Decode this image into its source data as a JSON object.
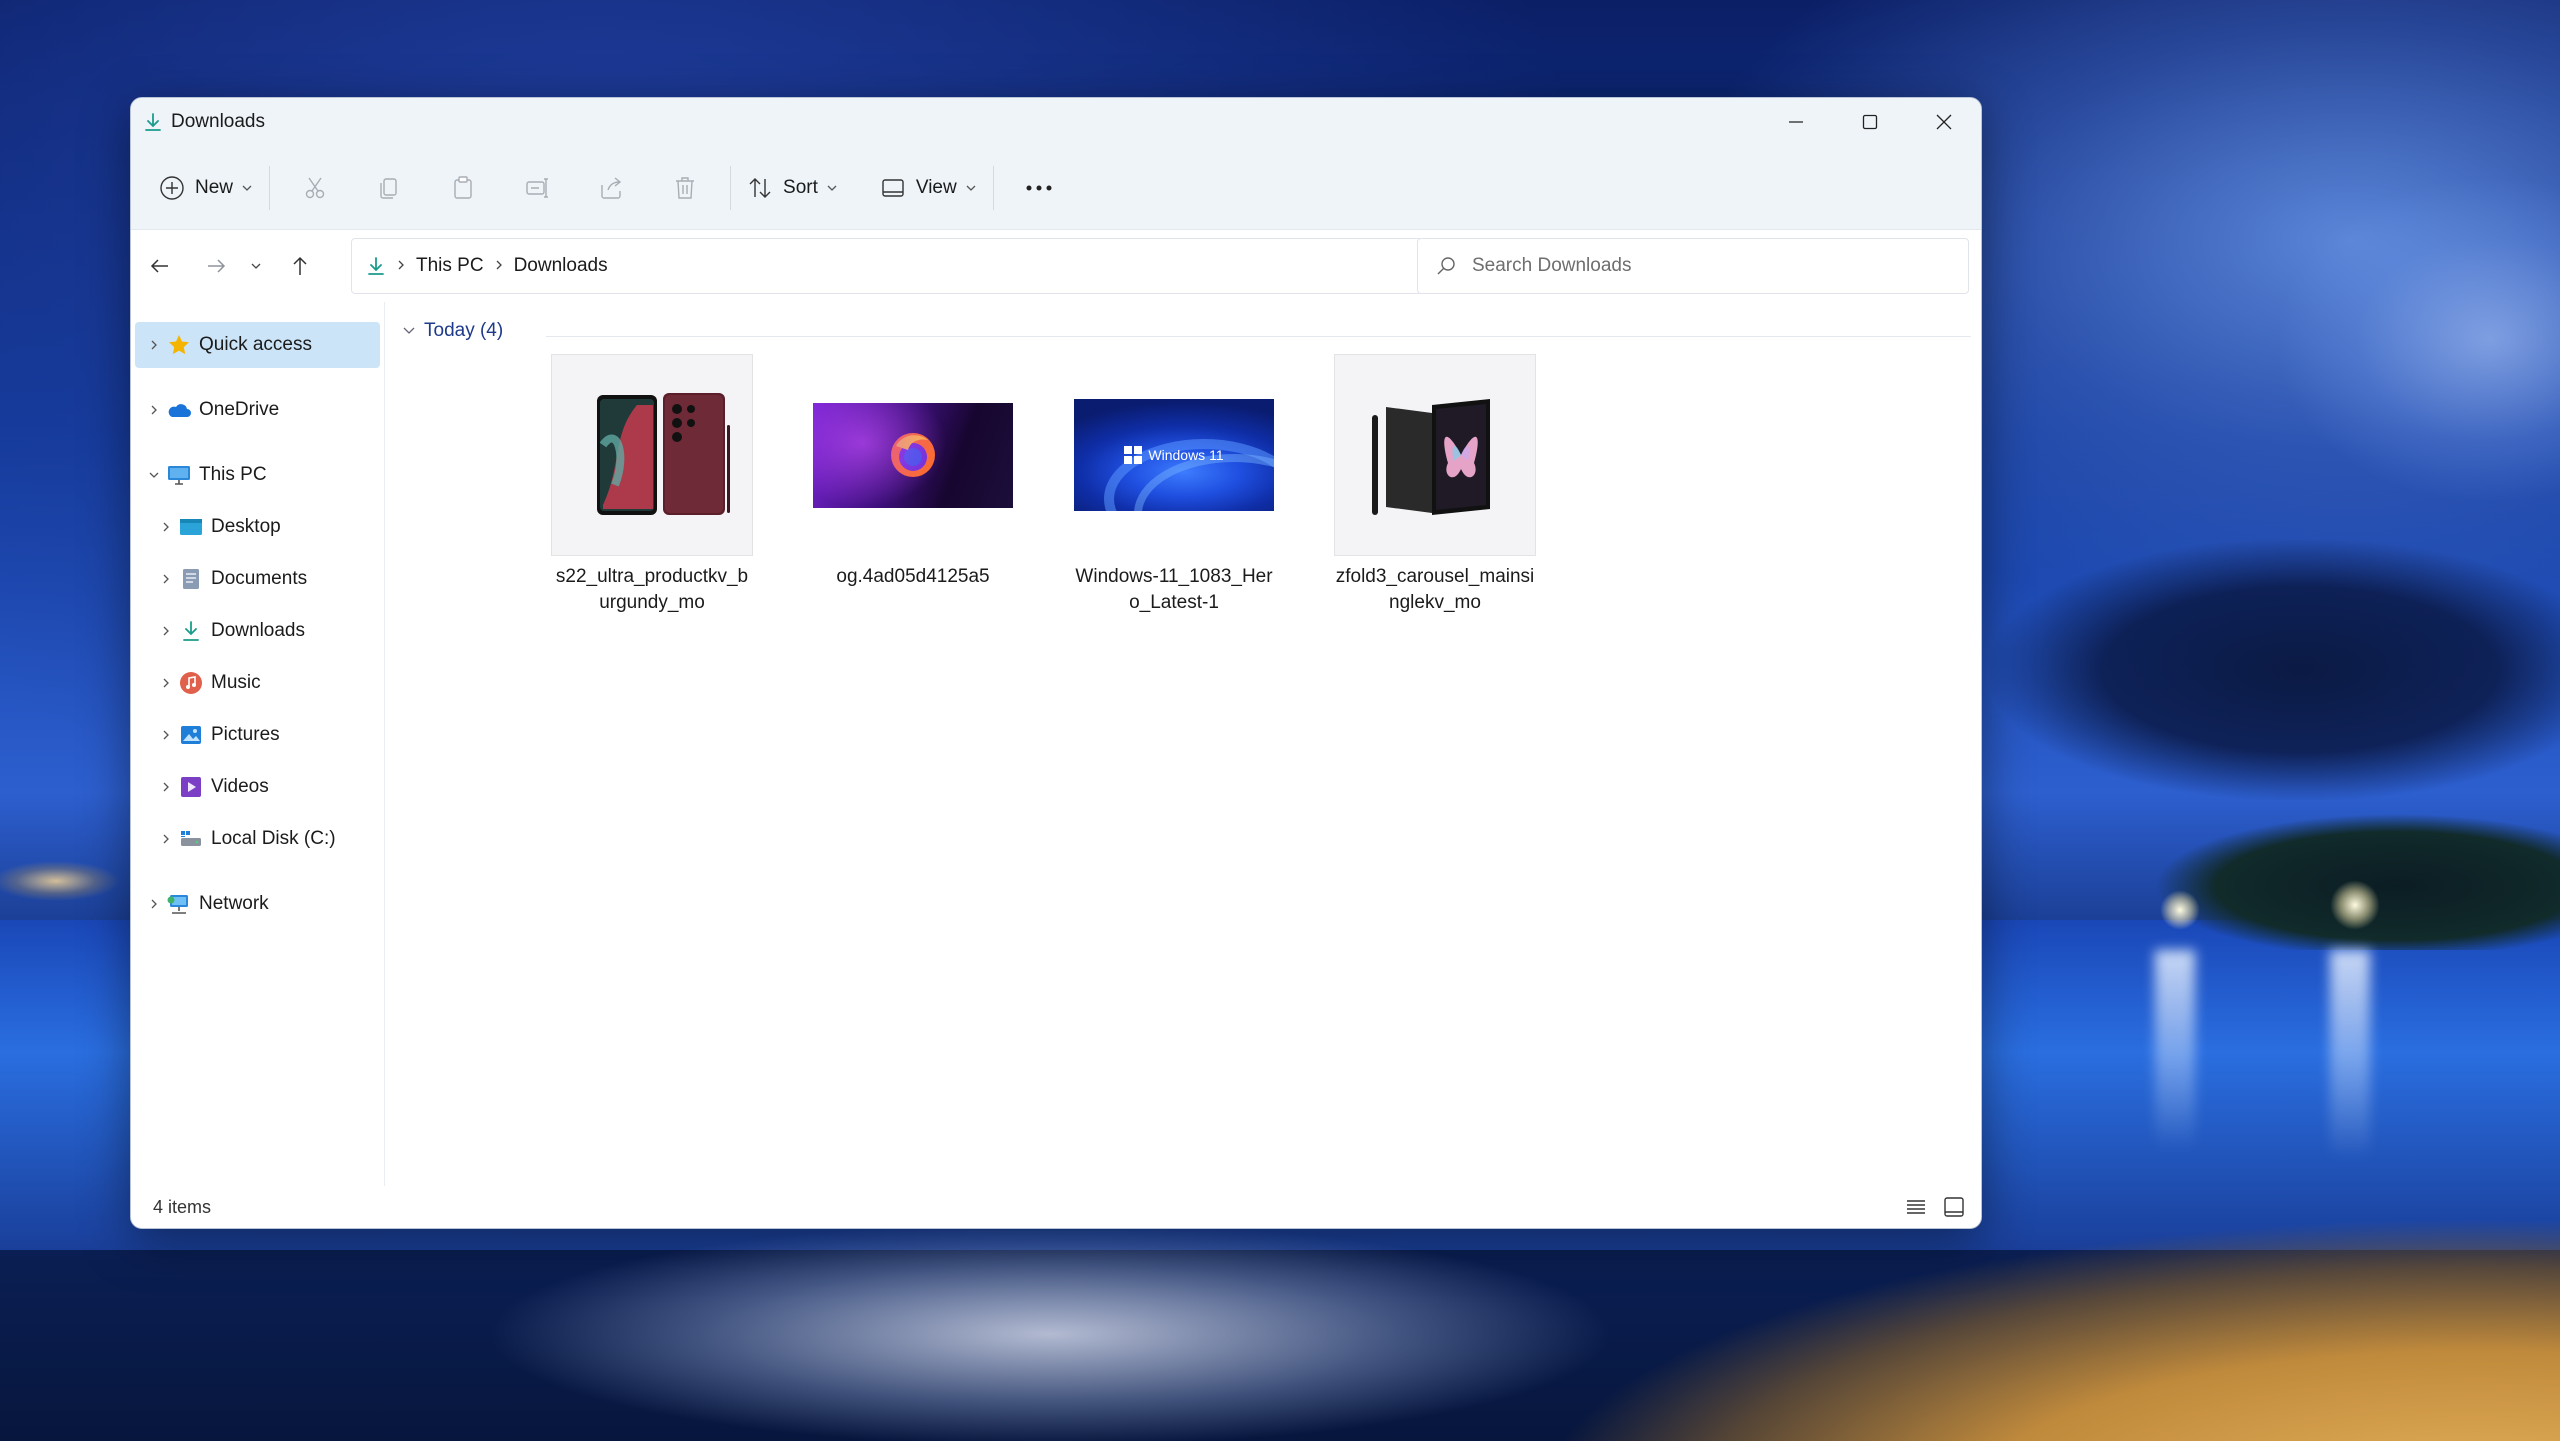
{
  "window": {
    "title": "Downloads"
  },
  "commandbar": {
    "new_label": "New",
    "sort_label": "Sort",
    "view_label": "View",
    "more_label": "..."
  },
  "address": {
    "breadcrumbs": [
      "This PC",
      "Downloads"
    ]
  },
  "search": {
    "placeholder": "Search Downloads"
  },
  "sidebar": {
    "items": [
      {
        "label": "Quick access",
        "icon": "star-icon"
      },
      {
        "label": "OneDrive",
        "icon": "cloud-icon"
      },
      {
        "label": "This PC",
        "icon": "computer-icon"
      },
      {
        "label": "Desktop",
        "icon": "desktop-folder-icon"
      },
      {
        "label": "Documents",
        "icon": "documents-icon"
      },
      {
        "label": "Downloads",
        "icon": "download-icon"
      },
      {
        "label": "Music",
        "icon": "music-icon"
      },
      {
        "label": "Pictures",
        "icon": "pictures-icon"
      },
      {
        "label": "Videos",
        "icon": "videos-icon"
      },
      {
        "label": "Local Disk (C:)",
        "icon": "drive-icon"
      },
      {
        "label": "Network",
        "icon": "network-icon"
      }
    ]
  },
  "content": {
    "group_label": "Today (4)",
    "files": [
      {
        "name": "s22_ultra_productkv_burgundy_mo"
      },
      {
        "name": "og.4ad05d4125a5"
      },
      {
        "name": "Windows-11_1083_Hero_Latest-1"
      },
      {
        "name": "zfold3_carousel_mainsinglekv_mo"
      }
    ],
    "win11_thumb_text": "Windows 11"
  },
  "status": {
    "item_count": "4 items"
  },
  "colors": {
    "accent": "#0067c0",
    "selection": "#cce4f7",
    "group_header": "#1e3a8a"
  }
}
